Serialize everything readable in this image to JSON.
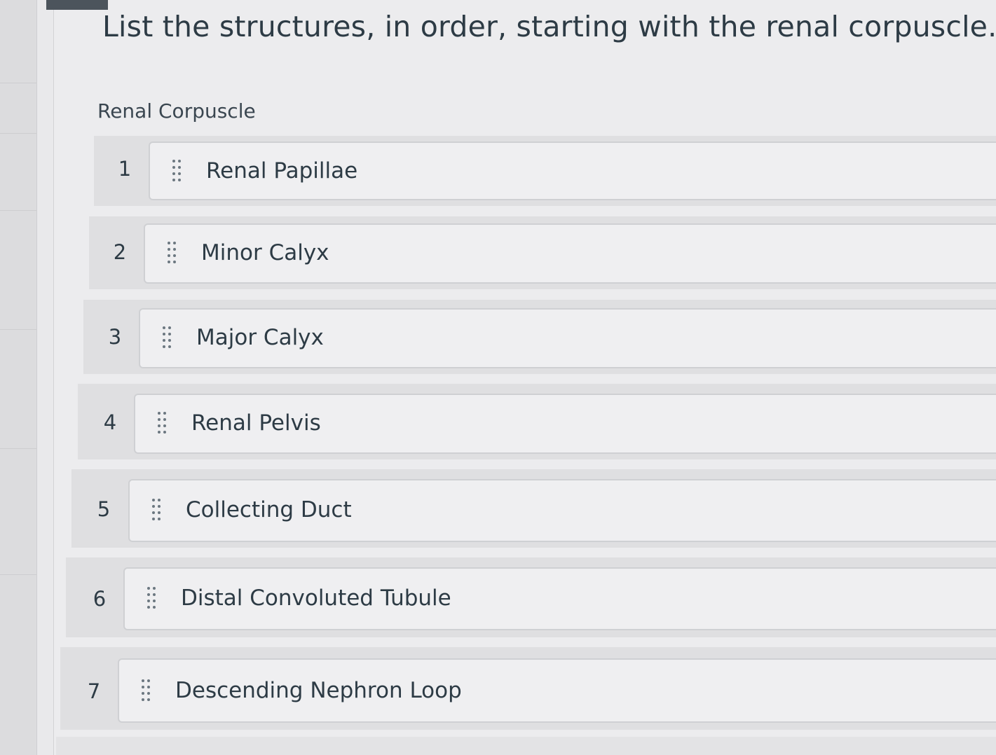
{
  "question": {
    "prompt": "List the structures, in order, starting with the renal corpuscle.",
    "start_label": "Renal Corpuscle"
  },
  "ordering_list": {
    "items": [
      {
        "number": "1",
        "label": "Renal Papillae"
      },
      {
        "number": "2",
        "label": "Minor Calyx"
      },
      {
        "number": "3",
        "label": "Major Calyx"
      },
      {
        "number": "4",
        "label": "Renal Pelvis"
      },
      {
        "number": "5",
        "label": "Collecting Duct"
      },
      {
        "number": "6",
        "label": "Distal Convoluted Tubule"
      },
      {
        "number": "7",
        "label": "Descending Nephron Loop"
      }
    ]
  },
  "icons": {
    "drag_handle": "drag-handle-icon"
  }
}
